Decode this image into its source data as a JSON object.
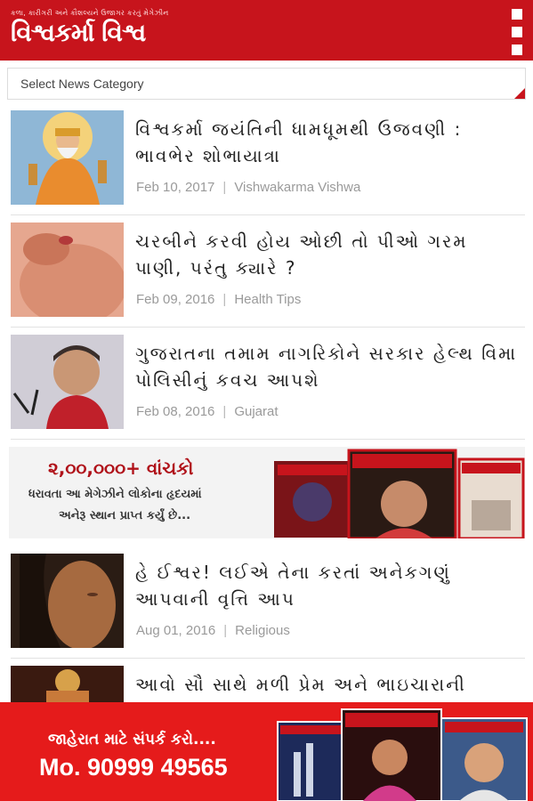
{
  "header": {
    "tagline": "કળા, કારીગરી અને કૌશલ્યને ઉજાગર કરતું મેગેઝીન",
    "logo_text": "વિશ્વકર્મા વિશ્વ",
    "brand_color": "#c7141c"
  },
  "category_select": {
    "label": "Select News Category"
  },
  "news": [
    {
      "title": "વિશ્વકર્મા જયંતિની ધામધૂમથી ઉજવણી : ભાવભેર શોભાયાત્રા",
      "date": "Feb 10, 2017",
      "category": "Vishwakarma Vishwa",
      "thumb_icon": "deity-image"
    },
    {
      "title": "ચરબીને કરવી હોય ઓછી તો પીઓ ગરમ પાણી, પરંતુ ક્યારે ?",
      "date": "Feb 09, 2016",
      "category": "Health Tips",
      "thumb_icon": "health-image"
    },
    {
      "title": "ગુજરાતના તમામ નાગરિકોને સરકાર હેલ્થ વિમા પોલિસીનું કવચ આપશે",
      "date": "Feb 08, 2016",
      "category": "Gujarat",
      "thumb_icon": "politician-image"
    },
    {
      "title": "હે ઈશ્વર! લઈએ તેના કરતાં અનેકગણું આપવાની વૃત્તિ આપ",
      "date": "Aug 01, 2016",
      "category": "Religious",
      "thumb_icon": "woman-portrait-image"
    },
    {
      "title": "આવો સૌ સાથે મળી પ્રેમ અને ભાઇચારાની",
      "date": "",
      "category": "",
      "thumb_icon": "dancer-image"
    }
  ],
  "banner_ad": {
    "line1": "૨,૦૦,૦૦૦+ વાંચકો",
    "line2": "ધરાવતા આ મેગેઝીને લોકોના હૃદયમાં",
    "line3": "અનેરૂ સ્થાન પ્રાપ્ત કર્યું છે..."
  },
  "footer_ad": {
    "line1": "જાહેરાત માટે સંપર્ક કરો....",
    "phone": "Mo. 90999 49565"
  }
}
